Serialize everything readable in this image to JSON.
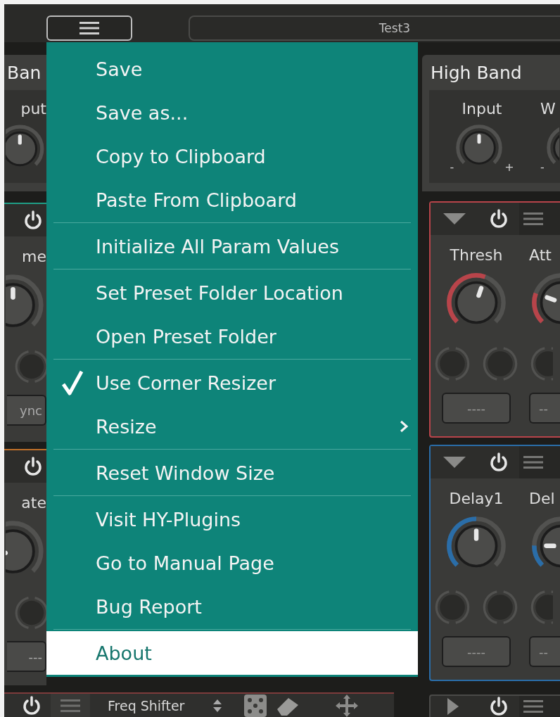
{
  "top_bar": {
    "preset_name": "Test3"
  },
  "left_column": {
    "band_panel": {
      "title": "Ban",
      "knob": {
        "label": "put",
        "level": 0.5
      }
    },
    "modules": [
      {
        "color": "#1f9e86",
        "label": "me",
        "level": 0.5,
        "button": "ync"
      },
      {
        "color": "#c0702a",
        "label": "ate",
        "level": 0.12,
        "button": "---"
      }
    ],
    "bottom_module": {
      "color": "#7d3b3b",
      "title": "Freq Shifter"
    }
  },
  "right_column": {
    "band_panel": {
      "title": "High Band",
      "knobs": [
        {
          "label": "Input",
          "level": 0.5,
          "min_label": "-",
          "max_label": "+"
        },
        {
          "label": "W",
          "min_label": "-"
        }
      ]
    },
    "modules": [
      {
        "color": "#b8444a",
        "expanded": true,
        "knobs": [
          {
            "label": "Thresh",
            "level": 0.57
          },
          {
            "label": "Att",
            "level": 0.24
          }
        ],
        "buttons": [
          "----",
          "--"
        ]
      },
      {
        "color": "#2a6da8",
        "expanded": true,
        "knobs": [
          {
            "label": "Delay1",
            "level": 0.5
          },
          {
            "label": "Del",
            "level": 0.17
          }
        ],
        "buttons": [
          "----",
          "--"
        ]
      },
      {
        "color": "#4a4a48",
        "expanded": false
      }
    ]
  },
  "menu": {
    "items": [
      {
        "kind": "item",
        "label": "Save",
        "checked": false,
        "submenu": false,
        "selected": false
      },
      {
        "kind": "item",
        "label": "Save as...",
        "checked": false,
        "submenu": false,
        "selected": false
      },
      {
        "kind": "item",
        "label": "Copy to Clipboard",
        "checked": false,
        "submenu": false,
        "selected": false
      },
      {
        "kind": "item",
        "label": "Paste From Clipboard",
        "checked": false,
        "submenu": false,
        "selected": false
      },
      {
        "kind": "separator"
      },
      {
        "kind": "item",
        "label": "Initialize All Param Values",
        "checked": false,
        "submenu": false,
        "selected": false
      },
      {
        "kind": "separator"
      },
      {
        "kind": "item",
        "label": "Set Preset Folder Location",
        "checked": false,
        "submenu": false,
        "selected": false
      },
      {
        "kind": "item",
        "label": "Open Preset Folder",
        "checked": false,
        "submenu": false,
        "selected": false
      },
      {
        "kind": "separator"
      },
      {
        "kind": "item",
        "label": "Use Corner Resizer",
        "checked": true,
        "submenu": false,
        "selected": false
      },
      {
        "kind": "item",
        "label": "Resize",
        "checked": false,
        "submenu": true,
        "selected": false
      },
      {
        "kind": "separator"
      },
      {
        "kind": "item",
        "label": "Reset Window Size",
        "checked": false,
        "submenu": false,
        "selected": false
      },
      {
        "kind": "separator"
      },
      {
        "kind": "item",
        "label": "Visit HY-Plugins",
        "checked": false,
        "submenu": false,
        "selected": false
      },
      {
        "kind": "item",
        "label": "Go to Manual Page",
        "checked": false,
        "submenu": false,
        "selected": false
      },
      {
        "kind": "item",
        "label": "Bug Report",
        "checked": false,
        "submenu": false,
        "selected": false
      },
      {
        "kind": "separator"
      },
      {
        "kind": "item",
        "label": "About",
        "checked": false,
        "submenu": false,
        "selected": true
      }
    ]
  }
}
